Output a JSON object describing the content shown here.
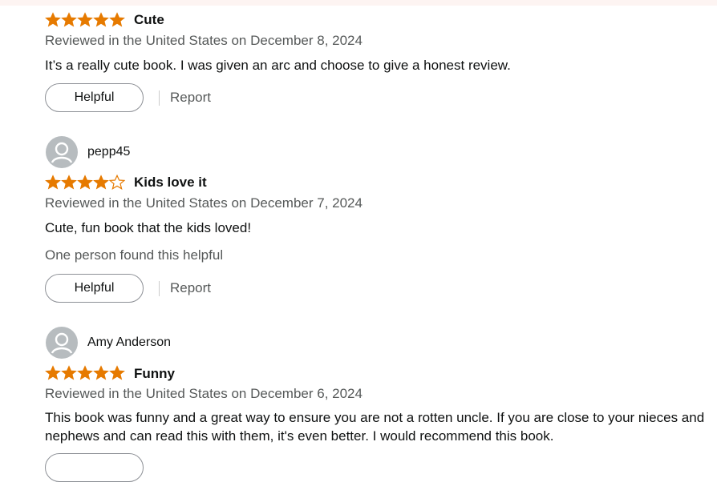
{
  "colors": {
    "star": "#e67a00",
    "star_outline": "#e67a00",
    "meta": "#565959",
    "text": "#0f1111",
    "avatar_bg": "#b7bcbf"
  },
  "reviews": [
    {
      "rating": 5,
      "title": "Cute",
      "meta": "Reviewed in the United States on December 8, 2024",
      "body": "It’s a really cute book. I was given an arc and choose to give a honest review.",
      "helpful_label": "Helpful",
      "report_label": "Report"
    },
    {
      "reviewer": "pepp45",
      "rating": 4,
      "title": "Kids love it",
      "meta": "Reviewed in the United States on December 7, 2024",
      "body": "Cute, fun book that the kids loved!",
      "helpful_count_text": "One person found this helpful",
      "helpful_label": "Helpful",
      "report_label": "Report"
    },
    {
      "reviewer": "Amy Anderson",
      "rating": 5,
      "title": "Funny",
      "meta": "Reviewed in the United States on December 6, 2024",
      "body": "This book was funny and a great way to ensure you are not a rotten uncle. If you are close to your nieces and nephews and can read this with them, it's even better. I would recommend this book."
    }
  ]
}
